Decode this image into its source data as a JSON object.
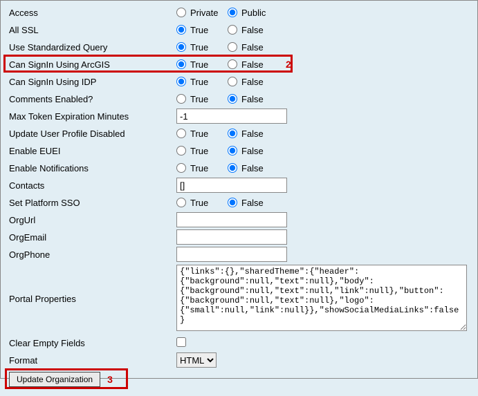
{
  "rows": {
    "access": {
      "label": "Access",
      "opt1": "Private",
      "opt2": "Public",
      "selected": 2
    },
    "allSsl": {
      "label": "All SSL",
      "opt1": "True",
      "opt2": "False",
      "selected": 1
    },
    "stdQuery": {
      "label": "Use Standardized Query",
      "opt1": "True",
      "opt2": "False",
      "selected": 1
    },
    "signinArcgis": {
      "label": "Can SignIn Using ArcGIS",
      "opt1": "True",
      "opt2": "False",
      "selected": 1
    },
    "signinIdp": {
      "label": "Can SignIn Using IDP",
      "opt1": "True",
      "opt2": "False",
      "selected": 1
    },
    "comments": {
      "label": "Comments Enabled?",
      "opt1": "True",
      "opt2": "False",
      "selected": 2
    },
    "maxToken": {
      "label": "Max Token Expiration Minutes",
      "value": "-1"
    },
    "updateProfile": {
      "label": "Update User Profile Disabled",
      "opt1": "True",
      "opt2": "False",
      "selected": 2
    },
    "euei": {
      "label": "Enable EUEI",
      "opt1": "True",
      "opt2": "False",
      "selected": 2
    },
    "notifications": {
      "label": "Enable Notifications",
      "opt1": "True",
      "opt2": "False",
      "selected": 2
    },
    "contacts": {
      "label": "Contacts",
      "value": "[]"
    },
    "platformSso": {
      "label": "Set Platform SSO",
      "opt1": "True",
      "opt2": "False",
      "selected": 2
    },
    "orgUrl": {
      "label": "OrgUrl",
      "value": ""
    },
    "orgEmail": {
      "label": "OrgEmail",
      "value": ""
    },
    "orgPhone": {
      "label": "OrgPhone",
      "value": ""
    },
    "portalProps": {
      "label": "Portal Properties",
      "value": "{\"links\":{},\"sharedTheme\":{\"header\":{\"background\":null,\"text\":null},\"body\":{\"background\":null,\"text\":null,\"link\":null},\"button\":{\"background\":null,\"text\":null},\"logo\":{\"small\":null,\"link\":null}},\"showSocialMediaLinks\":false}"
    },
    "clearEmpty": {
      "label": "Clear Empty Fields"
    },
    "format": {
      "label": "Format",
      "value": "HTML"
    }
  },
  "submit": {
    "label": "Update Organization"
  },
  "annotations": {
    "signin": "2",
    "submit": "3"
  }
}
